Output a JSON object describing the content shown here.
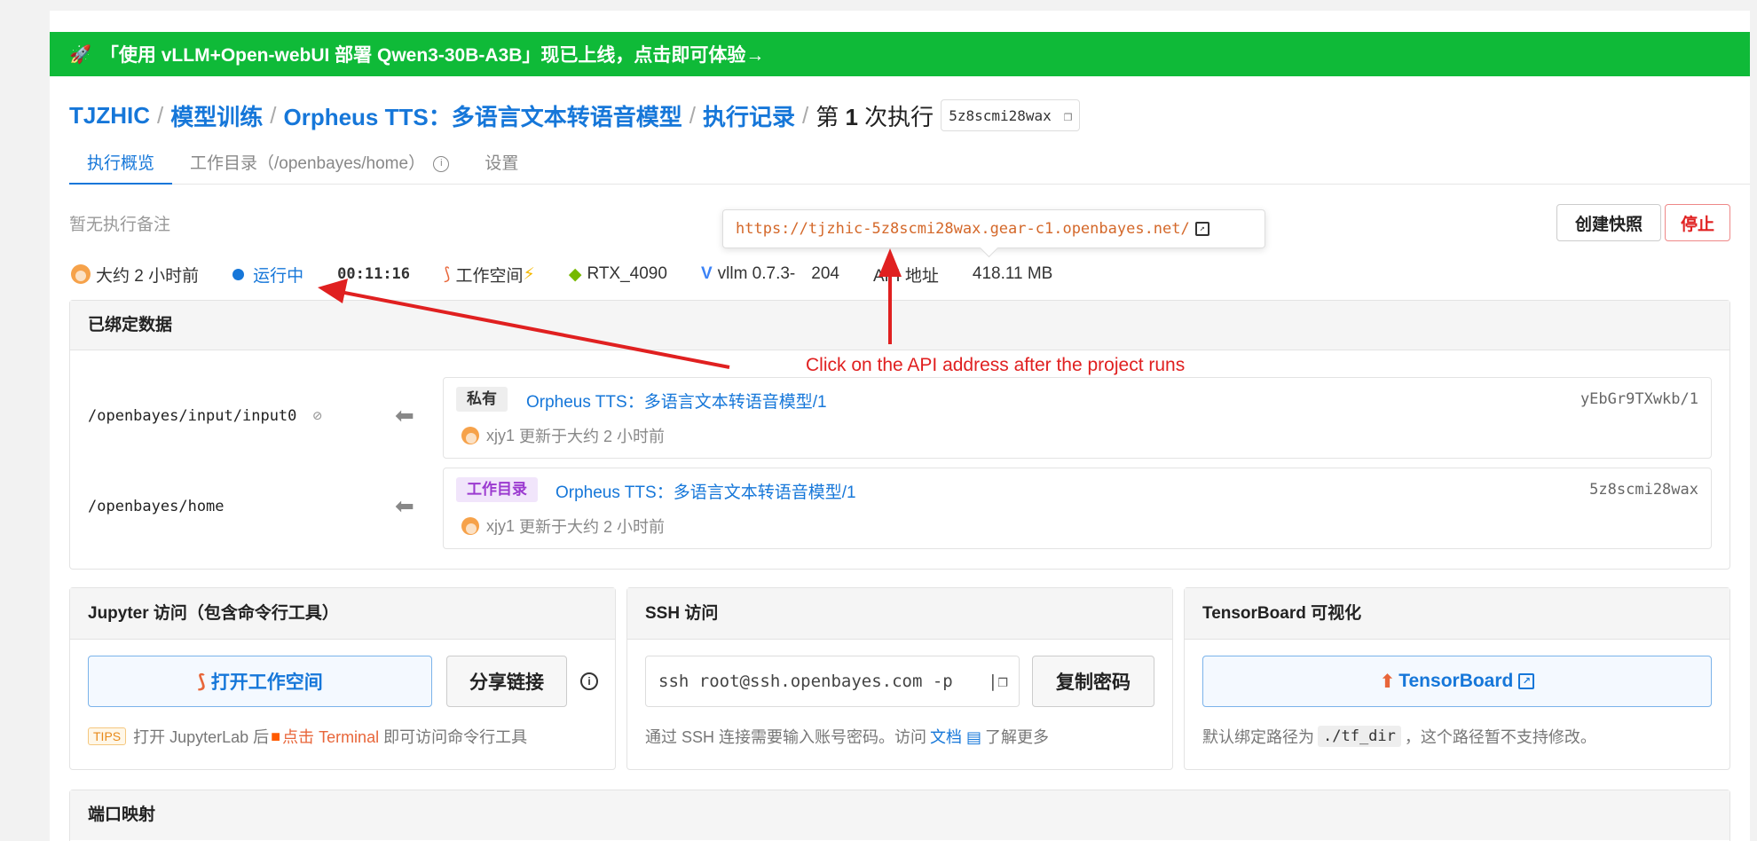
{
  "banner": {
    "icon": "rocket-icon",
    "text": "「使用 vLLM+Open-webUI 部署 Qwen3-30B-A3B」现已上线，点击即可体验→"
  },
  "breadcrumb": {
    "org": "TJZHIC",
    "section": "模型训练",
    "project": "Orpheus TTS：多语言文本转语音模型",
    "records": "执行记录",
    "current_prefix": "第",
    "current_num": "1",
    "current_suffix": "次执行",
    "run_id": "5z8scmi28wax"
  },
  "tabs": [
    {
      "label": "执行概览",
      "active": true
    },
    {
      "label": "工作目录（/openbayes/home）"
    },
    {
      "label": "设置"
    }
  ],
  "note": "暂无执行备注",
  "actions": {
    "snapshot": "创建快照",
    "stop": "停止"
  },
  "tooltip_url": "https://tjzhic-5z8scmi28wax.gear-c1.openbayes.net/",
  "meta": {
    "created": "大约 2 小时前",
    "status": "运行中",
    "duration": "00:11:16",
    "workspace": "工作空间",
    "gpu": "RTX_4090",
    "image": "vllm 0.7.3-",
    "image_tail": "204",
    "api": "API 地址",
    "size": "418.11 MB"
  },
  "bound": {
    "title": "已绑定数据",
    "rows": [
      {
        "path": "/openbayes/input/input0",
        "tag": "私有",
        "name": "Orpheus TTS：多语言文本转语音模型/1",
        "version": "yEbGr9TXwkb/1",
        "user": "xjy1",
        "updated": "更新于大约 2 小时前"
      },
      {
        "path": "/openbayes/home",
        "tag": "工作目录",
        "name": "Orpheus TTS：多语言文本转语音模型/1",
        "version": "5z8scmi28wax",
        "user": "xjy1",
        "updated": "更新于大约 2 小时前"
      }
    ]
  },
  "jupyter": {
    "title": "Jupyter 访问（包含命令行工具）",
    "open": "打开工作空间",
    "share": "分享链接",
    "tips": "TIPS",
    "foot_a": "打开 JupyterLab 后",
    "foot_b": "点击 Terminal",
    "foot_c": "即可访问命令行工具"
  },
  "ssh": {
    "title": "SSH 访问",
    "command": "ssh root@ssh.openbayes.com -p",
    "copy_pwd": "复制密码",
    "foot_a": "通过 SSH 连接需要输入账号密码。访问",
    "foot_link": "文档",
    "foot_b": "了解更多"
  },
  "tensorboard": {
    "title": "TensorBoard 可视化",
    "button": "TensorBoard",
    "foot_a": "默认绑定路径为",
    "foot_code": "./tf_dir",
    "foot_b": "，这个路径暂不支持修改。"
  },
  "ports": {
    "title": "端口映射"
  },
  "annotation": "Click on the API address after the project runs",
  "colors": {
    "banner": "#0fba38",
    "link": "#1677d9",
    "annotation": "#e02020"
  }
}
